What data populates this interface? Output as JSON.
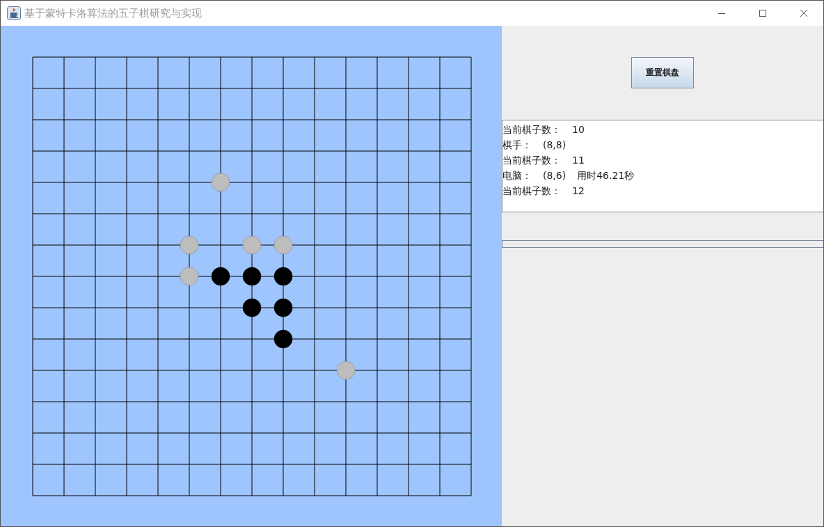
{
  "window": {
    "title": "基于蒙特卡洛算法的五子棋研究与实现"
  },
  "board": {
    "rows": [
      {
        "points": [
          {
            "kind": "empty"
          },
          {
            "kind": "empty"
          },
          {
            "kind": "empty"
          },
          {
            "kind": "empty"
          },
          {
            "kind": "empty"
          },
          {
            "kind": "empty"
          },
          {
            "kind": "empty"
          },
          {
            "kind": "empty"
          },
          {
            "kind": "empty"
          },
          {
            "kind": "empty"
          },
          {
            "kind": "empty"
          },
          {
            "kind": "empty"
          },
          {
            "kind": "empty"
          },
          {
            "kind": "empty"
          },
          {
            "kind": "empty"
          }
        ]
      },
      {
        "points": [
          {
            "kind": "empty"
          },
          {
            "kind": "empty"
          },
          {
            "kind": "empty"
          },
          {
            "kind": "empty"
          },
          {
            "kind": "empty"
          },
          {
            "kind": "empty"
          },
          {
            "kind": "empty"
          },
          {
            "kind": "empty"
          },
          {
            "kind": "empty"
          },
          {
            "kind": "empty"
          },
          {
            "kind": "empty"
          },
          {
            "kind": "empty"
          },
          {
            "kind": "empty"
          },
          {
            "kind": "empty"
          },
          {
            "kind": "empty"
          }
        ]
      },
      {
        "points": [
          {
            "kind": "empty"
          },
          {
            "kind": "empty"
          },
          {
            "kind": "empty"
          },
          {
            "kind": "empty"
          },
          {
            "kind": "empty"
          },
          {
            "kind": "empty"
          },
          {
            "kind": "empty"
          },
          {
            "kind": "empty"
          },
          {
            "kind": "empty"
          },
          {
            "kind": "empty"
          },
          {
            "kind": "empty"
          },
          {
            "kind": "empty"
          },
          {
            "kind": "empty"
          },
          {
            "kind": "empty"
          },
          {
            "kind": "empty"
          }
        ]
      },
      {
        "points": [
          {
            "kind": "empty"
          },
          {
            "kind": "empty"
          },
          {
            "kind": "empty"
          },
          {
            "kind": "empty"
          },
          {
            "kind": "empty"
          },
          {
            "kind": "empty"
          },
          {
            "kind": "empty"
          },
          {
            "kind": "empty"
          },
          {
            "kind": "empty"
          },
          {
            "kind": "empty"
          },
          {
            "kind": "empty"
          },
          {
            "kind": "empty"
          },
          {
            "kind": "empty"
          },
          {
            "kind": "empty"
          },
          {
            "kind": "empty"
          }
        ]
      },
      {
        "points": [
          {
            "kind": "empty"
          },
          {
            "kind": "empty"
          },
          {
            "kind": "empty"
          },
          {
            "kind": "empty"
          },
          {
            "kind": "empty"
          },
          {
            "kind": "empty"
          },
          {
            "kind": "gray"
          },
          {
            "kind": "empty"
          },
          {
            "kind": "empty"
          },
          {
            "kind": "empty"
          },
          {
            "kind": "empty"
          },
          {
            "kind": "empty"
          },
          {
            "kind": "empty"
          },
          {
            "kind": "empty"
          },
          {
            "kind": "empty"
          }
        ]
      },
      {
        "points": [
          {
            "kind": "empty"
          },
          {
            "kind": "empty"
          },
          {
            "kind": "empty"
          },
          {
            "kind": "empty"
          },
          {
            "kind": "empty"
          },
          {
            "kind": "empty"
          },
          {
            "kind": "empty"
          },
          {
            "kind": "empty"
          },
          {
            "kind": "empty"
          },
          {
            "kind": "empty"
          },
          {
            "kind": "empty"
          },
          {
            "kind": "empty"
          },
          {
            "kind": "empty"
          },
          {
            "kind": "empty"
          },
          {
            "kind": "empty"
          }
        ]
      },
      {
        "points": [
          {
            "kind": "empty"
          },
          {
            "kind": "empty"
          },
          {
            "kind": "empty"
          },
          {
            "kind": "empty"
          },
          {
            "kind": "empty"
          },
          {
            "kind": "gray"
          },
          {
            "kind": "empty"
          },
          {
            "kind": "gray"
          },
          {
            "kind": "gray"
          },
          {
            "kind": "empty"
          },
          {
            "kind": "empty"
          },
          {
            "kind": "empty"
          },
          {
            "kind": "empty"
          },
          {
            "kind": "empty"
          },
          {
            "kind": "empty"
          }
        ]
      },
      {
        "points": [
          {
            "kind": "empty"
          },
          {
            "kind": "empty"
          },
          {
            "kind": "empty"
          },
          {
            "kind": "empty"
          },
          {
            "kind": "empty"
          },
          {
            "kind": "gray"
          },
          {
            "kind": "black"
          },
          {
            "kind": "black"
          },
          {
            "kind": "black"
          },
          {
            "kind": "empty"
          },
          {
            "kind": "empty"
          },
          {
            "kind": "empty"
          },
          {
            "kind": "empty"
          },
          {
            "kind": "empty"
          },
          {
            "kind": "empty"
          }
        ]
      },
      {
        "points": [
          {
            "kind": "empty"
          },
          {
            "kind": "empty"
          },
          {
            "kind": "empty"
          },
          {
            "kind": "empty"
          },
          {
            "kind": "empty"
          },
          {
            "kind": "empty"
          },
          {
            "kind": "empty"
          },
          {
            "kind": "black"
          },
          {
            "kind": "black"
          },
          {
            "kind": "empty"
          },
          {
            "kind": "empty"
          },
          {
            "kind": "empty"
          },
          {
            "kind": "empty"
          },
          {
            "kind": "empty"
          },
          {
            "kind": "empty"
          }
        ]
      },
      {
        "points": [
          {
            "kind": "empty"
          },
          {
            "kind": "empty"
          },
          {
            "kind": "empty"
          },
          {
            "kind": "empty"
          },
          {
            "kind": "empty"
          },
          {
            "kind": "empty"
          },
          {
            "kind": "empty"
          },
          {
            "kind": "empty"
          },
          {
            "kind": "black"
          },
          {
            "kind": "empty"
          },
          {
            "kind": "empty"
          },
          {
            "kind": "empty"
          },
          {
            "kind": "empty"
          },
          {
            "kind": "empty"
          },
          {
            "kind": "empty"
          }
        ]
      },
      {
        "points": [
          {
            "kind": "empty"
          },
          {
            "kind": "empty"
          },
          {
            "kind": "empty"
          },
          {
            "kind": "empty"
          },
          {
            "kind": "empty"
          },
          {
            "kind": "empty"
          },
          {
            "kind": "empty"
          },
          {
            "kind": "empty"
          },
          {
            "kind": "empty"
          },
          {
            "kind": "empty"
          },
          {
            "kind": "gray"
          },
          {
            "kind": "empty"
          },
          {
            "kind": "empty"
          },
          {
            "kind": "empty"
          },
          {
            "kind": "empty"
          }
        ]
      },
      {
        "points": [
          {
            "kind": "empty"
          },
          {
            "kind": "empty"
          },
          {
            "kind": "empty"
          },
          {
            "kind": "empty"
          },
          {
            "kind": "empty"
          },
          {
            "kind": "empty"
          },
          {
            "kind": "empty"
          },
          {
            "kind": "empty"
          },
          {
            "kind": "empty"
          },
          {
            "kind": "empty"
          },
          {
            "kind": "empty"
          },
          {
            "kind": "empty"
          },
          {
            "kind": "empty"
          },
          {
            "kind": "empty"
          },
          {
            "kind": "empty"
          }
        ]
      },
      {
        "points": [
          {
            "kind": "empty"
          },
          {
            "kind": "empty"
          },
          {
            "kind": "empty"
          },
          {
            "kind": "empty"
          },
          {
            "kind": "empty"
          },
          {
            "kind": "empty"
          },
          {
            "kind": "empty"
          },
          {
            "kind": "empty"
          },
          {
            "kind": "empty"
          },
          {
            "kind": "empty"
          },
          {
            "kind": "empty"
          },
          {
            "kind": "empty"
          },
          {
            "kind": "empty"
          },
          {
            "kind": "empty"
          },
          {
            "kind": "empty"
          }
        ]
      },
      {
        "points": [
          {
            "kind": "empty"
          },
          {
            "kind": "empty"
          },
          {
            "kind": "empty"
          },
          {
            "kind": "empty"
          },
          {
            "kind": "empty"
          },
          {
            "kind": "empty"
          },
          {
            "kind": "empty"
          },
          {
            "kind": "empty"
          },
          {
            "kind": "empty"
          },
          {
            "kind": "empty"
          },
          {
            "kind": "empty"
          },
          {
            "kind": "empty"
          },
          {
            "kind": "empty"
          },
          {
            "kind": "empty"
          },
          {
            "kind": "empty"
          }
        ]
      },
      {
        "points": [
          {
            "kind": "empty"
          },
          {
            "kind": "empty"
          },
          {
            "kind": "empty"
          },
          {
            "kind": "empty"
          },
          {
            "kind": "empty"
          },
          {
            "kind": "empty"
          },
          {
            "kind": "empty"
          },
          {
            "kind": "empty"
          },
          {
            "kind": "empty"
          },
          {
            "kind": "empty"
          },
          {
            "kind": "empty"
          },
          {
            "kind": "empty"
          },
          {
            "kind": "empty"
          },
          {
            "kind": "empty"
          },
          {
            "kind": "empty"
          }
        ]
      }
    ]
  },
  "reset_button": {
    "label": "重置棋盘"
  },
  "log": [
    {
      "parts": [
        "当前棋子数：",
        "10"
      ]
    },
    {
      "parts": [
        "棋手：",
        "(8,8)"
      ]
    },
    {
      "parts": [
        "当前棋子数：",
        "11"
      ]
    },
    {
      "parts": [
        "电脑：",
        "(8,6)",
        "用时46.21秒"
      ]
    },
    {
      "parts": [
        "当前棋子数：",
        "12"
      ]
    }
  ],
  "progress": {
    "level": 0
  }
}
